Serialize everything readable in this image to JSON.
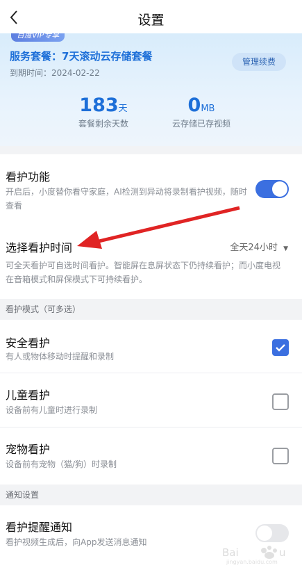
{
  "header": {
    "title": "设置"
  },
  "vip": {
    "badge": "百度VIP专享",
    "plan": "服务套餐：7天滚动云存储套餐",
    "expire": "到期时间：2024-02-22",
    "manage_label": "管理续费",
    "days_value": "183",
    "days_unit": "天",
    "days_label": "套餐剩余天数",
    "storage_value": "0",
    "storage_unit": "MB",
    "storage_label": "云存储已存视频"
  },
  "care": {
    "title": "看护功能",
    "desc": "开启后，小度替你看守家庭，AI检测到异动将录制看护视频，随时查看",
    "enabled": true
  },
  "care_time": {
    "title": "选择看护时间",
    "value": "全天24小时",
    "desc": "可全天看护可自选时间看护。智能屏在息屏状态下仍持续看护；而小度电视在音箱模式和屏保模式下可持续看护。"
  },
  "modes": {
    "header": "看护模式（可多选）",
    "items": [
      {
        "title": "安全看护",
        "desc": "有人或物体移动时提醒和录制",
        "checked": true
      },
      {
        "title": "儿童看护",
        "desc": "设备前有儿童时进行录制",
        "checked": false
      },
      {
        "title": "宠物看护",
        "desc": "设备前有宠物（猫/狗）时录制",
        "checked": false
      }
    ]
  },
  "notify": {
    "header": "通知设置",
    "title": "看护提醒通知",
    "desc": "看护视频生成后，向App发送消息通知",
    "enabled": false
  },
  "colors": {
    "accent": "#3b6fe0",
    "annotation_arrow": "#e02424"
  },
  "watermark": "Baidu经验"
}
